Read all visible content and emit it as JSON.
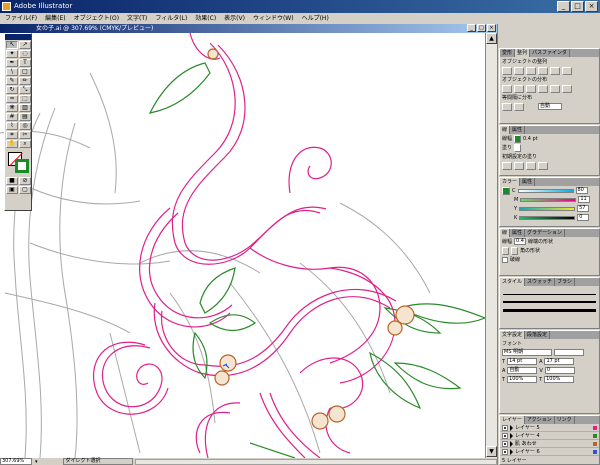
{
  "app": {
    "title": "Adobe Illustrator"
  },
  "menu": [
    "ファイル(F)",
    "編集(E)",
    "オブジェクト(O)",
    "文字(T)",
    "フィルタ(L)",
    "効果(C)",
    "表示(V)",
    "ウィンドウ(W)",
    "ヘルプ(H)"
  ],
  "document": {
    "title": "女の子.ai @ 307.69% (CMYK/プレビュー)"
  },
  "status": {
    "zoom": "307.69%",
    "tool": "ダイレクト選択"
  },
  "panels": {
    "align": {
      "tabs": [
        "変形",
        "整列",
        "パスファインダ"
      ],
      "distribute_label": "オブジェクトの整列",
      "distribute_label2": "オブジェクトの分布",
      "spacing_label": "等間隔に分布",
      "spacing_value": "自動"
    },
    "stroke": {
      "tabs": [
        "線",
        "属性"
      ],
      "width_label": "線幅",
      "width_value": "0.4 pt",
      "fill_label": "塗り",
      "note": "初期設定の塗り"
    },
    "color": {
      "tabs": [
        "カラー",
        "属性"
      ],
      "channels": [
        {
          "label": "C",
          "value": "80"
        },
        {
          "label": "M",
          "value": "11"
        },
        {
          "label": "Y",
          "value": "57"
        },
        {
          "label": "K",
          "value": "0"
        }
      ]
    },
    "strokeopts": {
      "tabs": [
        "線",
        "属性",
        "グラデーション"
      ],
      "width_label": "線幅",
      "width_value": "0.4",
      "cap_label": "線端の形状",
      "join_label": "角の形状",
      "dash_label": "破線"
    },
    "styles": {
      "tabs": [
        "スタイル",
        "スウォッチ",
        "ブラシ"
      ]
    },
    "char": {
      "tabs": [
        "文字設定",
        "段落設定"
      ],
      "font_label": "フォント",
      "font_value": "MS 明朝",
      "size": "14 pt",
      "leading": "17 pt",
      "tracking": "自動",
      "kern": "0",
      "hscale": "100%",
      "vscale": "100%"
    },
    "layers": {
      "tabs": [
        "レイヤー",
        "アクション",
        "リンク"
      ],
      "items": [
        "レイヤー 5",
        "レイヤー 4",
        "肌 あわせ",
        "レイヤー 6",
        "レイヤー 3"
      ],
      "footer": "5 レイヤー"
    }
  },
  "colors": {
    "pink": "#e0208a",
    "green": "#2a8a2a",
    "brown": "#b8642a",
    "sketch": "#a0a0a0"
  }
}
